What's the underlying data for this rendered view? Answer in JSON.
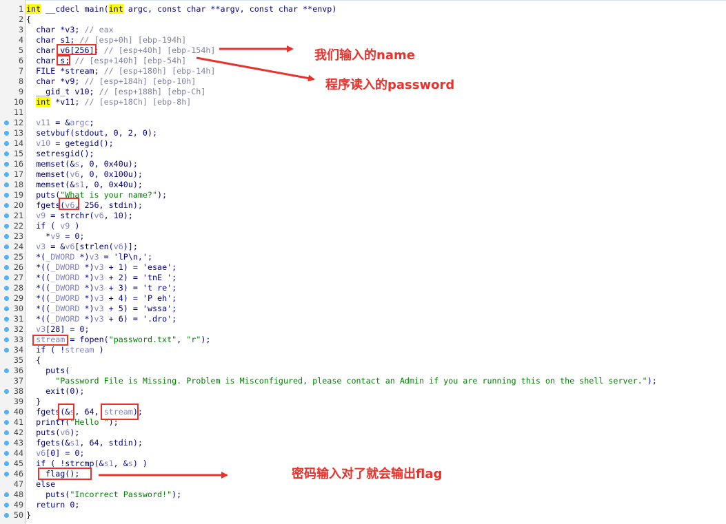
{
  "code_lines": [
    {
      "n": "1",
      "segs": [
        {
          "t": "int",
          "c": "kw"
        },
        {
          "t": " __cdecl main("
        },
        {
          "t": "int",
          "c": "kw"
        },
        {
          "t": " argc, const char **argv, const char **envp)"
        }
      ]
    },
    {
      "n": "2",
      "segs": [
        {
          "t": "{"
        }
      ]
    },
    {
      "n": "3",
      "segs": [
        {
          "t": "  char *v3; "
        },
        {
          "t": "// eax",
          "c": "cm"
        }
      ]
    },
    {
      "n": "4",
      "segs": [
        {
          "t": "  char s1; "
        },
        {
          "t": "// [esp+0h] [ebp-194h]",
          "c": "cm"
        }
      ]
    },
    {
      "n": "5",
      "segs": [
        {
          "t": "  char v6[256]; "
        },
        {
          "t": "// [esp+40h] [ebp-154h]",
          "c": "cm"
        }
      ]
    },
    {
      "n": "6",
      "segs": [
        {
          "t": "  char s; "
        },
        {
          "t": "// [esp+140h] [ebp-54h]",
          "c": "cm"
        }
      ]
    },
    {
      "n": "7",
      "segs": [
        {
          "t": "  FILE *stream; "
        },
        {
          "t": "// [esp+180h] [ebp-14h]",
          "c": "cm"
        }
      ]
    },
    {
      "n": "8",
      "segs": [
        {
          "t": "  char *v9; "
        },
        {
          "t": "// [esp+184h] [ebp-10h]",
          "c": "cm"
        }
      ]
    },
    {
      "n": "9",
      "segs": [
        {
          "t": "  __gid_t v10; "
        },
        {
          "t": "// [esp+188h] [ebp-Ch]",
          "c": "cm"
        }
      ]
    },
    {
      "n": "10",
      "segs": [
        {
          "t": "  "
        },
        {
          "t": "int",
          "c": "kw"
        },
        {
          "t": " *v11; "
        },
        {
          "t": "// [esp+18Ch] [ebp-8h]",
          "c": "cm"
        }
      ]
    },
    {
      "n": "11",
      "segs": []
    },
    {
      "n": "12",
      "bp": true,
      "segs": [
        {
          "t": "  "
        },
        {
          "t": "v11",
          "c": "gr"
        },
        {
          "t": " = &"
        },
        {
          "t": "argc",
          "c": "gr"
        },
        {
          "t": ";"
        }
      ]
    },
    {
      "n": "13",
      "bp": true,
      "segs": [
        {
          "t": "  setvbuf(stdout, 0, 2, 0);"
        }
      ]
    },
    {
      "n": "14",
      "bp": true,
      "segs": [
        {
          "t": "  "
        },
        {
          "t": "v10",
          "c": "gr"
        },
        {
          "t": " = getegid();"
        }
      ]
    },
    {
      "n": "15",
      "bp": true,
      "segs": [
        {
          "t": "  setresgid();"
        }
      ]
    },
    {
      "n": "16",
      "bp": true,
      "segs": [
        {
          "t": "  memset(&"
        },
        {
          "t": "s",
          "c": "gr"
        },
        {
          "t": ", 0, 0x40u);"
        }
      ]
    },
    {
      "n": "17",
      "bp": true,
      "segs": [
        {
          "t": "  memset("
        },
        {
          "t": "v6",
          "c": "gr"
        },
        {
          "t": ", 0, 0x100u);"
        }
      ]
    },
    {
      "n": "18",
      "bp": true,
      "segs": [
        {
          "t": "  memset(&"
        },
        {
          "t": "s1",
          "c": "gr"
        },
        {
          "t": ", 0, 0x40u);"
        }
      ]
    },
    {
      "n": "19",
      "bp": true,
      "segs": [
        {
          "t": "  puts("
        },
        {
          "t": "\"What is your name?\"",
          "c": "str"
        },
        {
          "t": ");"
        }
      ]
    },
    {
      "n": "20",
      "bp": true,
      "segs": [
        {
          "t": "  fgets("
        },
        {
          "t": "v6",
          "c": "gr"
        },
        {
          "t": ", 256, stdin);"
        }
      ]
    },
    {
      "n": "21",
      "bp": true,
      "segs": [
        {
          "t": "  "
        },
        {
          "t": "v9",
          "c": "gr"
        },
        {
          "t": " = strchr("
        },
        {
          "t": "v6",
          "c": "gr"
        },
        {
          "t": ", 10);"
        }
      ]
    },
    {
      "n": "22",
      "bp": true,
      "segs": [
        {
          "t": "  if ( "
        },
        {
          "t": "v9",
          "c": "gr"
        },
        {
          "t": " )"
        }
      ]
    },
    {
      "n": "23",
      "bp": true,
      "segs": [
        {
          "t": "    *"
        },
        {
          "t": "v9",
          "c": "gr"
        },
        {
          "t": " = 0;"
        }
      ]
    },
    {
      "n": "24",
      "bp": true,
      "segs": [
        {
          "t": "  "
        },
        {
          "t": "v3",
          "c": "gr"
        },
        {
          "t": " = &"
        },
        {
          "t": "v6",
          "c": "gr"
        },
        {
          "t": "[strlen("
        },
        {
          "t": "v6",
          "c": "gr"
        },
        {
          "t": ")];"
        }
      ]
    },
    {
      "n": "25",
      "bp": true,
      "segs": [
        {
          "t": "  *("
        },
        {
          "t": "_DWORD",
          "c": "gr"
        },
        {
          "t": " *)"
        },
        {
          "t": "v3",
          "c": "gr"
        },
        {
          "t": " = 'lP\\n,';"
        }
      ]
    },
    {
      "n": "26",
      "bp": true,
      "segs": [
        {
          "t": "  *(("
        },
        {
          "t": "_DWORD",
          "c": "gr"
        },
        {
          "t": " *)"
        },
        {
          "t": "v3",
          "c": "gr"
        },
        {
          "t": " + 1) = 'esae';"
        }
      ]
    },
    {
      "n": "27",
      "bp": true,
      "segs": [
        {
          "t": "  *(("
        },
        {
          "t": "_DWORD",
          "c": "gr"
        },
        {
          "t": " *)"
        },
        {
          "t": "v3",
          "c": "gr"
        },
        {
          "t": " + 2) = 'tnE ';"
        }
      ]
    },
    {
      "n": "28",
      "bp": true,
      "segs": [
        {
          "t": "  *(("
        },
        {
          "t": "_DWORD",
          "c": "gr"
        },
        {
          "t": " *)"
        },
        {
          "t": "v3",
          "c": "gr"
        },
        {
          "t": " + 3) = 't re';"
        }
      ]
    },
    {
      "n": "29",
      "bp": true,
      "segs": [
        {
          "t": "  *(("
        },
        {
          "t": "_DWORD",
          "c": "gr"
        },
        {
          "t": " *)"
        },
        {
          "t": "v3",
          "c": "gr"
        },
        {
          "t": " + 4) = 'P eh';"
        }
      ]
    },
    {
      "n": "30",
      "bp": true,
      "segs": [
        {
          "t": "  *(("
        },
        {
          "t": "_DWORD",
          "c": "gr"
        },
        {
          "t": " *)"
        },
        {
          "t": "v3",
          "c": "gr"
        },
        {
          "t": " + 5) = 'wssa';"
        }
      ]
    },
    {
      "n": "31",
      "bp": true,
      "segs": [
        {
          "t": "  *(("
        },
        {
          "t": "_DWORD",
          "c": "gr"
        },
        {
          "t": " *)"
        },
        {
          "t": "v3",
          "c": "gr"
        },
        {
          "t": " + 6) = '.dro';"
        }
      ]
    },
    {
      "n": "32",
      "bp": true,
      "segs": [
        {
          "t": "  "
        },
        {
          "t": "v3",
          "c": "gr"
        },
        {
          "t": "[28] = 0;"
        }
      ]
    },
    {
      "n": "33",
      "bp": true,
      "segs": [
        {
          "t": "  "
        },
        {
          "t": "stream",
          "c": "gr"
        },
        {
          "t": " = fopen("
        },
        {
          "t": "\"password.txt\"",
          "c": "str"
        },
        {
          "t": ", "
        },
        {
          "t": "\"r\"",
          "c": "str"
        },
        {
          "t": ");"
        }
      ]
    },
    {
      "n": "34",
      "bp": true,
      "segs": [
        {
          "t": "  if ( !"
        },
        {
          "t": "stream",
          "c": "gr"
        },
        {
          "t": " )"
        }
      ]
    },
    {
      "n": "35",
      "segs": [
        {
          "t": "  {"
        }
      ]
    },
    {
      "n": "36",
      "bp": true,
      "segs": [
        {
          "t": "    puts("
        }
      ]
    },
    {
      "n": "37",
      "segs": [
        {
          "t": "      "
        },
        {
          "t": "\"Password File is Missing. Problem is Misconfigured, please contact an Admin if you are running this on the shell server.\"",
          "c": "str"
        },
        {
          "t": ");"
        }
      ]
    },
    {
      "n": "38",
      "bp": true,
      "segs": [
        {
          "t": "    exit(0);"
        }
      ]
    },
    {
      "n": "39",
      "segs": [
        {
          "t": "  }"
        }
      ]
    },
    {
      "n": "40",
      "bp": true,
      "segs": [
        {
          "t": "  fgets(&"
        },
        {
          "t": "s",
          "c": "gr"
        },
        {
          "t": ", 64, "
        },
        {
          "t": "stream",
          "c": "gr"
        },
        {
          "t": ");"
        }
      ]
    },
    {
      "n": "41",
      "bp": true,
      "segs": [
        {
          "t": "  printf("
        },
        {
          "t": "\"Hello \"",
          "c": "str"
        },
        {
          "t": ");"
        }
      ]
    },
    {
      "n": "42",
      "bp": true,
      "segs": [
        {
          "t": "  puts("
        },
        {
          "t": "v6",
          "c": "gr"
        },
        {
          "t": ");"
        }
      ]
    },
    {
      "n": "43",
      "bp": true,
      "segs": [
        {
          "t": "  fgets(&"
        },
        {
          "t": "s1",
          "c": "gr"
        },
        {
          "t": ", 64, stdin);"
        }
      ]
    },
    {
      "n": "44",
      "bp": true,
      "segs": [
        {
          "t": "  "
        },
        {
          "t": "v6",
          "c": "gr"
        },
        {
          "t": "[0] = 0;"
        }
      ]
    },
    {
      "n": "45",
      "bp": true,
      "segs": [
        {
          "t": "  if ( !strcmp(&"
        },
        {
          "t": "s1",
          "c": "gr"
        },
        {
          "t": ", &"
        },
        {
          "t": "s",
          "c": "gr"
        },
        {
          "t": ") )"
        }
      ]
    },
    {
      "n": "46",
      "bp": true,
      "segs": [
        {
          "t": "    flag();"
        }
      ]
    },
    {
      "n": "47",
      "segs": [
        {
          "t": "  else"
        }
      ]
    },
    {
      "n": "48",
      "bp": true,
      "segs": [
        {
          "t": "    puts("
        },
        {
          "t": "\"Incorrect Password!\"",
          "c": "str"
        },
        {
          "t": ");"
        }
      ]
    },
    {
      "n": "49",
      "bp": true,
      "segs": [
        {
          "t": "  return 0;"
        }
      ]
    },
    {
      "n": "50",
      "bp": true,
      "segs": [
        {
          "t": "}"
        }
      ]
    }
  ],
  "annotations": {
    "name_note": "我们输入的name",
    "password_note": "程序读入的password",
    "flag_note": "密码输入对了就会输出flag"
  },
  "colors": {
    "annotation": "#e8322b",
    "keyword_highlight": "#ffff00",
    "code_text": "#000080",
    "comment": "#8080a0",
    "string": "#008000",
    "breakpoint_dot": "#55b1f0"
  }
}
